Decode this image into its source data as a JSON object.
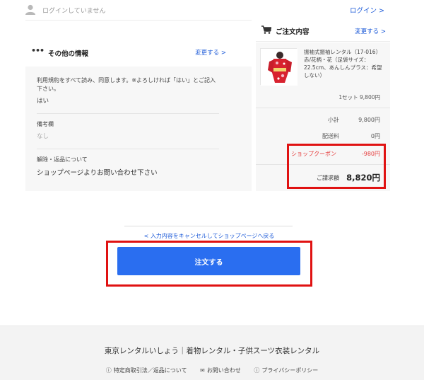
{
  "header": {
    "login_status": "ログインしていません",
    "login_link": "ログイン",
    "link_arrow": ">"
  },
  "other_info": {
    "dots": "•••",
    "title": "その他の情報",
    "change_link": "変更する",
    "fields": [
      {
        "label": "利用規約をすべて読み、同意します。※よろしければ「はい」とご記入下さい。",
        "value": "はい"
      },
      {
        "label": "備考欄",
        "value": "なし"
      },
      {
        "label": "解除・返品について",
        "value": "ショップページよりお問い合わせ下さい"
      }
    ]
  },
  "order": {
    "title": "ご注文内容",
    "change_link": "変更する",
    "item_name": "振袖式振袖レンタル（17-016）赤/花柄・花（足袋サイズ：22.5cm、あんしんプラス：希望しない）",
    "quantity_price": "1セット  9,800円",
    "subtotal_label": "小計",
    "subtotal_value": "9,800円",
    "shipping_label": "配送料",
    "shipping_value": "0円",
    "coupon_label": "ショップクーポン",
    "coupon_value": "-980円",
    "total_label": "ご請求額",
    "total_value": "8,820円"
  },
  "actions": {
    "cancel_link": "入力内容をキャンセルしてショップページへ戻る",
    "order_button": "注文する"
  },
  "footer": {
    "shop_name": "東京レンタルいしょう｜着物レンタル・子供スーツ衣装レンタル",
    "links": [
      {
        "icon": "info-circle-icon",
        "glyph": "ⓘ",
        "label": "特定商取引法／返品について"
      },
      {
        "icon": "mail-icon",
        "glyph": "✉",
        "label": "お問い合わせ"
      },
      {
        "icon": "info-circle-icon",
        "glyph": "ⓘ",
        "label": "プライバシーポリシー"
      }
    ]
  },
  "colors": {
    "accent": "#2a6ef0",
    "link": "#1e5bd8",
    "highlight_border": "#e01212",
    "coupon": "#e53b3b"
  }
}
